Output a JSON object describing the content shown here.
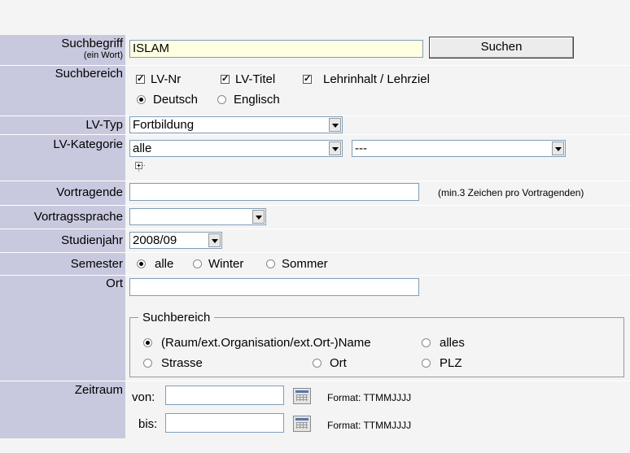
{
  "search": {
    "label": "Suchbegriff",
    "sublabel": "(ein Wort)",
    "value": "ISLAM",
    "button": "Suchen"
  },
  "scope": {
    "label": "Suchbereich",
    "checkboxes": [
      {
        "label": "LV-Nr",
        "checked": true
      },
      {
        "label": "LV-Titel",
        "checked": true
      },
      {
        "label": "Lehrinhalt / Lehrziel",
        "checked": true
      }
    ],
    "languages": [
      {
        "label": "Deutsch",
        "selected": true
      },
      {
        "label": "Englisch",
        "selected": false
      }
    ]
  },
  "lv_typ": {
    "label": "LV-Typ",
    "value": "Fortbildung"
  },
  "lv_kategorie": {
    "label": "LV-Kategorie",
    "value": "alle",
    "value2": "---"
  },
  "vortragende": {
    "label": "Vortragende",
    "value": "",
    "hint": "(min.3 Zeichen pro Vortragenden)"
  },
  "vortragssprache": {
    "label": "Vortragssprache",
    "value": ""
  },
  "studienjahr": {
    "label": "Studienjahr",
    "value": "2008/09"
  },
  "semester": {
    "label": "Semester",
    "options": [
      {
        "label": "alle",
        "selected": true
      },
      {
        "label": "Winter",
        "selected": false
      },
      {
        "label": "Sommer",
        "selected": false
      }
    ]
  },
  "ort": {
    "label": "Ort",
    "value": "",
    "fieldset_legend": "Suchbereich",
    "options": [
      {
        "label": "(Raum/ext.Organisation/ext.Ort-)Name",
        "selected": true
      },
      {
        "label": "alles",
        "selected": false
      },
      {
        "label": "Strasse",
        "selected": false
      },
      {
        "label": "Ort",
        "selected": false
      },
      {
        "label": "PLZ",
        "selected": false
      }
    ]
  },
  "zeitraum": {
    "label": "Zeitraum",
    "from_label": "von:",
    "to_label": "bis:",
    "from_value": "",
    "to_value": "",
    "format_hint": "Format: TTMMJJJJ"
  }
}
